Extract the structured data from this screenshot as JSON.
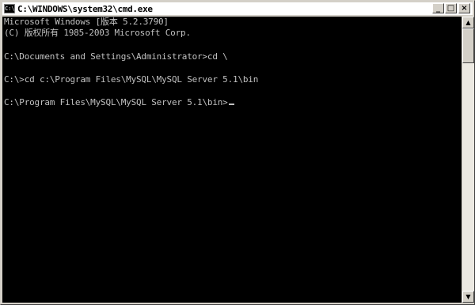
{
  "window": {
    "title": "C:\\WINDOWS\\system32\\cmd.exe",
    "icon_label": "C:\\",
    "buttons": {
      "minimize": "_",
      "maximize": "□",
      "close": "×"
    }
  },
  "console": {
    "lines": [
      "Microsoft Windows [版本 5.2.3790]",
      "(C) 版权所有 1985-2003 Microsoft Corp.",
      "",
      "C:\\Documents and Settings\\Administrator>cd \\",
      "",
      "C:\\>cd c:\\Program Files\\MySQL\\MySQL Server 5.1\\bin",
      "",
      "C:\\Program Files\\MySQL\\MySQL Server 5.1\\bin>"
    ],
    "colors": {
      "background": "#000000",
      "foreground": "#c0c0c0"
    }
  },
  "scrollbar": {
    "up_arrow": "▲",
    "down_arrow": "▼"
  }
}
